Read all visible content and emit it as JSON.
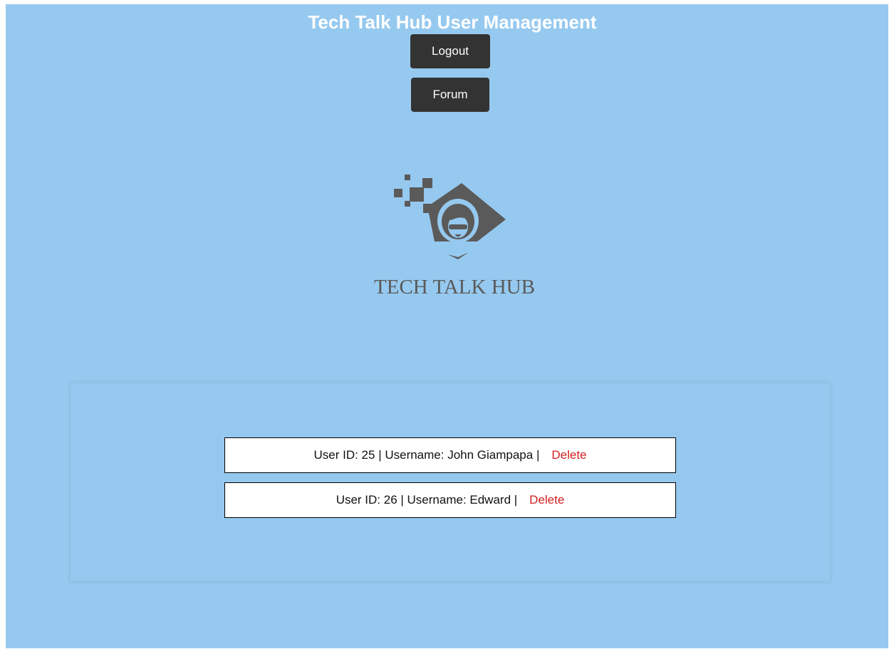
{
  "header": {
    "title": "Tech Talk Hub User Management"
  },
  "nav": {
    "logout_label": "Logout",
    "forum_label": "Forum"
  },
  "logo": {
    "text": "TECH TALK HUB",
    "icon": "hooded-figure-logo"
  },
  "users": [
    {
      "text": "User ID: 25 | Username: John Giampapa |",
      "delete_label": "Delete"
    },
    {
      "text": "User ID: 26 | Username: Edward |",
      "delete_label": "Delete"
    }
  ],
  "colors": {
    "background": "#96c9ef",
    "button": "#333333",
    "delete": "#d21f1f",
    "logo": "#5a5a5a"
  }
}
